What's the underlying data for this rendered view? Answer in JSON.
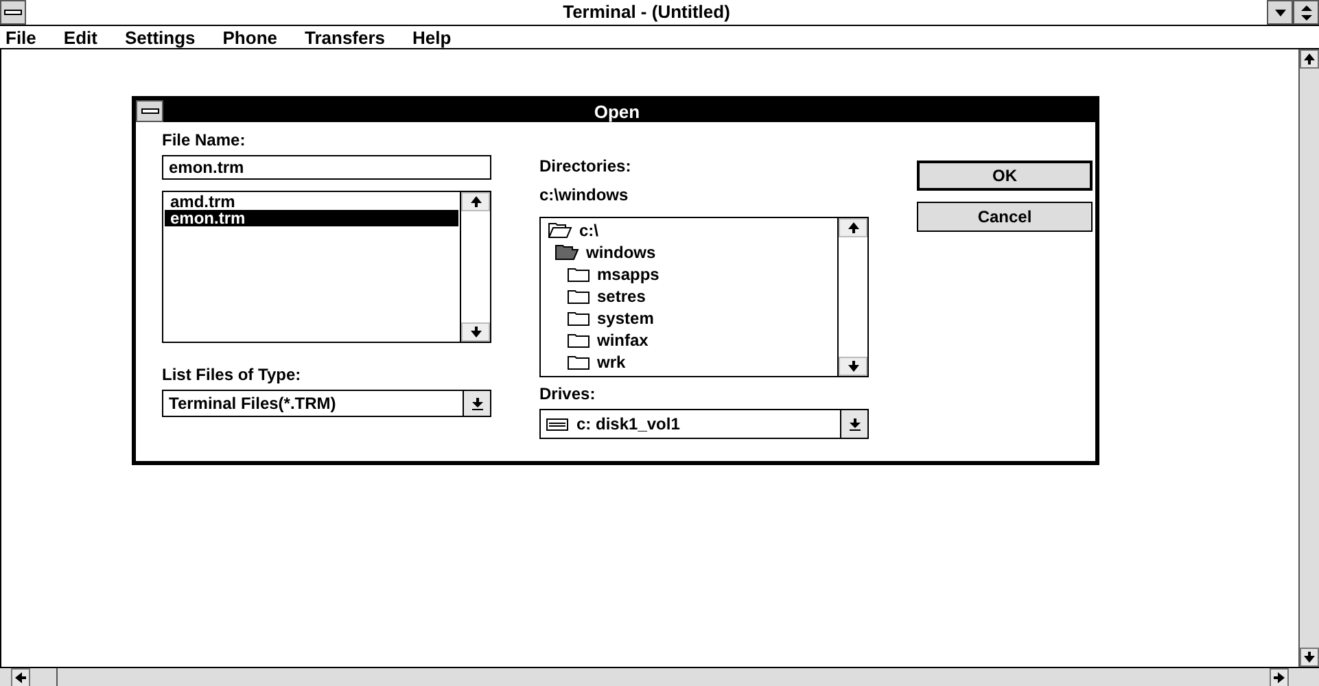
{
  "window": {
    "title": "Terminal - (Untitled)"
  },
  "menu": [
    "File",
    "Edit",
    "Settings",
    "Phone",
    "Transfers",
    "Help"
  ],
  "dialog": {
    "title": "Open",
    "file_name": {
      "label": "File Name:",
      "value": "emon.trm"
    },
    "files": [
      {
        "name": "amd.trm",
        "selected": false
      },
      {
        "name": "emon.trm",
        "selected": true
      }
    ],
    "file_type": {
      "label": "List Files of Type:",
      "value": "Terminal Files(*.TRM)"
    },
    "directories": {
      "label": "Directories:",
      "path": "c:\\windows",
      "tree": [
        {
          "name": "c:\\",
          "kind": "root",
          "children": [
            {
              "name": "windows",
              "kind": "current",
              "children": [
                {
                  "name": "msapps",
                  "kind": "folder"
                },
                {
                  "name": "setres",
                  "kind": "folder"
                },
                {
                  "name": "system",
                  "kind": "folder"
                },
                {
                  "name": "winfax",
                  "kind": "folder"
                },
                {
                  "name": "wrk",
                  "kind": "folder"
                }
              ]
            }
          ]
        }
      ]
    },
    "drives": {
      "label": "Drives:",
      "value": "c: disk1_vol1"
    },
    "buttons": [
      "OK",
      "Cancel"
    ]
  }
}
